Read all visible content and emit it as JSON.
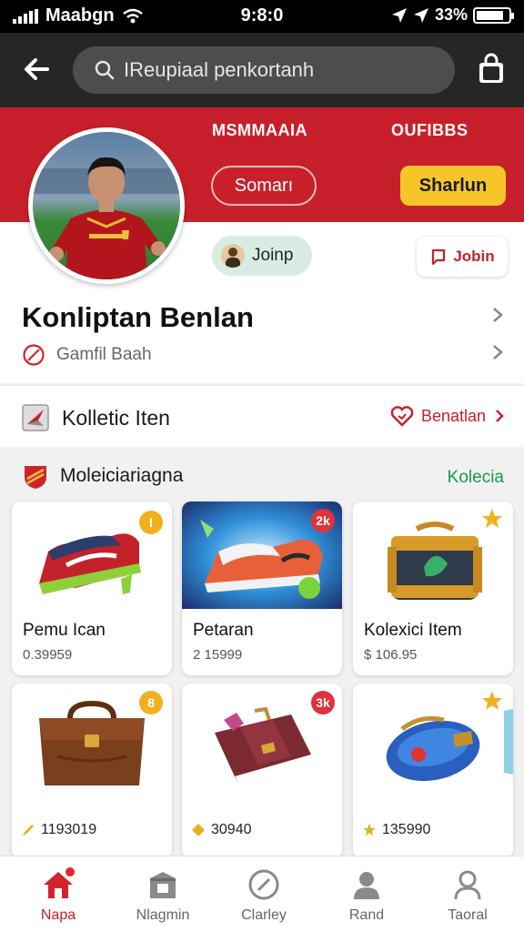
{
  "status_bar": {
    "carrier": "Maabgn",
    "time": "9:8:0",
    "battery": "33%"
  },
  "header": {
    "search_placeholder": "IReupiaal penkortanh"
  },
  "profile": {
    "stat_1": "MSMMAAIA",
    "stat_2": "OUFIBBS",
    "button_outline": "Somarı",
    "button_primary": "Sharlun",
    "chip_join": "Joinp",
    "chip_follow": "Jobin",
    "name": "Konliptan Benlan",
    "subtitle": "Gamfil Baah"
  },
  "collection_row": {
    "title": "Kolletic Iten",
    "action": "Benatlan"
  },
  "section": {
    "title": "Moleiciariagna",
    "link": "Kolecia"
  },
  "items": [
    {
      "name": "Pemu Ican",
      "price": "0.39959",
      "badge": "I",
      "badge_color": "#f2b01e"
    },
    {
      "name": "Petaran",
      "price": "2 15999",
      "badge": "2k",
      "badge_color": "#e0323a"
    },
    {
      "name": "Kolexici Item",
      "price": "$ 106.95",
      "badge": "star",
      "badge_color": "#f2b01e"
    },
    {
      "name": "",
      "price": "1193019",
      "badge": "8",
      "badge_color": "#f2b01e"
    },
    {
      "name": "",
      "price": "30940",
      "badge": "3k",
      "badge_color": "#e0323a"
    },
    {
      "name": "",
      "price": "135990",
      "badge": "star",
      "badge_color": "#f2b01e"
    }
  ],
  "nav": [
    {
      "label": "Napa",
      "icon": "home-icon",
      "active": true
    },
    {
      "label": "Nlagmin",
      "icon": "store-icon"
    },
    {
      "label": "Clarley",
      "icon": "compass-icon"
    },
    {
      "label": "Rand",
      "icon": "person-icon"
    },
    {
      "label": "Taoral",
      "icon": "profile-icon"
    }
  ],
  "colors": {
    "brand_red": "#c8202a",
    "accent_yellow": "#f6c629",
    "link_green": "#1a9a4a"
  }
}
